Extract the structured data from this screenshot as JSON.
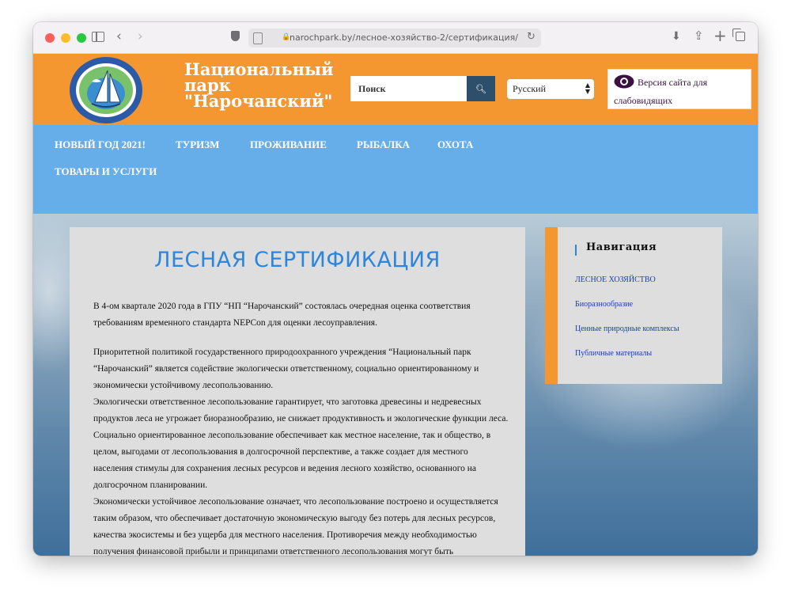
{
  "browser": {
    "url": "narochpark.by/лесное-хозяйство-2/сертификация/"
  },
  "header": {
    "site_name": "Национальный парк \"Нарочанский\"",
    "search_placeholder": "Поиск",
    "language": "Русский",
    "visually_impaired_label": "Версия сайта для слабовидящих",
    "logo_text_top": "НАЦИОНАЛЬНЫЙ ПАРК",
    "logo_text_bottom": "НАРОЧАНСКИЙ"
  },
  "nav": {
    "items": [
      {
        "label": "НОВЫЙ ГОД 2021!"
      },
      {
        "label": "ТУРИЗМ"
      },
      {
        "label": "ПРОЖИВАНИЕ"
      },
      {
        "label": "РЫБАЛКА"
      },
      {
        "label": "ОХОТА"
      },
      {
        "label": "ТОВАРЫ И УСЛУГИ"
      }
    ]
  },
  "main": {
    "title": "ЛЕСНАЯ СЕРТИФИКАЦИЯ",
    "paragraph1": "В 4-ом квартале 2020 года в ГПУ “НП “Нарочанский” состоялась очередная оценка соответствия требованиям временного стандарта NEPCon для оценки лесоуправления.",
    "paragraph2": "Приоритетной политикой государственного природоохранного учреждения “Национальный парк “Нарочанский” является содействие экологически ответственному, социально ориентированному и экономически устойчивому лесопользованию.",
    "paragraph3": "Экологически ответственное лесопользование гарантирует, что заготовка древесины и недревесных продуктов леса не угрожает биоразнообразию, не снижает продуктивность и экологические функции леса.",
    "paragraph4": "Социально ориентированное лесопользование обеспечивает как местное население, так и общество, в целом, выгодами от лесопользования в долгосрочной перспективе, а также создает для местного населения стимулы для сохранения лесных ресурсов и ведения лесного хозяйство, основанного на долгосрочном планировании.",
    "paragraph5": "Экономически устойчивое лесопользование означает, что лесопользование построено и осуществляется таким образом, что обеспечивает достаточную экономическую выгоду без потерь для лесных ресурсов, качества экосистемы и без ущерба для местного населения. Противоречия между необходимостью получения финансовой прибыли и принципами ответственного лесопользования могут быть минимизированы путем приложения усилий в производство лесной"
  },
  "sidebar": {
    "title": "Навигация",
    "links": [
      {
        "label": "ЛЕСНОЕ ХОЗЯЙСТВО"
      },
      {
        "label": "Биоразнообразие"
      },
      {
        "label": "Ценные природные комплексы"
      },
      {
        "label": "Публичные материалы"
      }
    ]
  },
  "colors": {
    "header_orange": "#f49731",
    "nav_blue": "#66aeea",
    "title_blue": "#2d86de",
    "search_button": "#2d4f6c"
  }
}
